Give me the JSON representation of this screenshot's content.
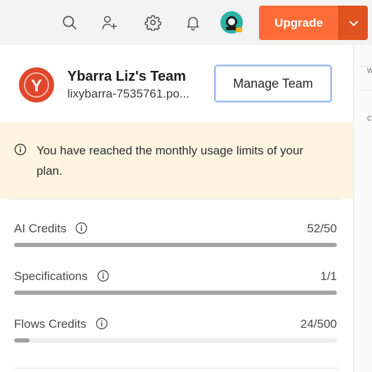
{
  "toolbar": {
    "icons": [
      "search-icon",
      "add-user-icon",
      "gear-icon",
      "bell-icon",
      "avatar-icon"
    ],
    "upgrade_label": "Upgrade",
    "accent": "#ff6c37",
    "accent_dark": "#e05320"
  },
  "team": {
    "initial": "Y",
    "logo_color": "#e0472b",
    "name": "Ybarra Liz's Team",
    "domain": "lixybarra-7535761.po...",
    "manage_label": "Manage Team"
  },
  "banner": {
    "icon": "info-icon",
    "text": "You have reached the monthly usage limits of your plan.",
    "background": "#fdf5e1"
  },
  "usage": [
    {
      "label": "AI Credits",
      "value": "52/50",
      "used": 52,
      "limit": 50
    },
    {
      "label": "Specifications",
      "value": "1/1",
      "used": 1,
      "limit": 1
    },
    {
      "label": "Flows Credits",
      "value": "24/500",
      "used": 24,
      "limit": 500
    }
  ]
}
